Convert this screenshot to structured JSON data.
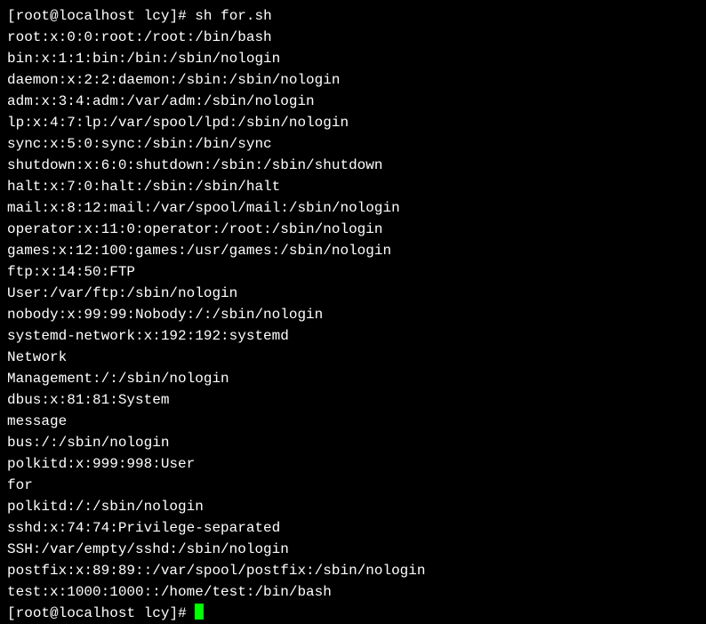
{
  "prompt1": {
    "user": "root",
    "at": "@",
    "host": "localhost",
    "path": "lcy",
    "symbol": "#",
    "command": "sh for.sh"
  },
  "output": [
    "root:x:0:0:root:/root:/bin/bash",
    "bin:x:1:1:bin:/bin:/sbin/nologin",
    "daemon:x:2:2:daemon:/sbin:/sbin/nologin",
    "adm:x:3:4:adm:/var/adm:/sbin/nologin",
    "lp:x:4:7:lp:/var/spool/lpd:/sbin/nologin",
    "sync:x:5:0:sync:/sbin:/bin/sync",
    "shutdown:x:6:0:shutdown:/sbin:/sbin/shutdown",
    "halt:x:7:0:halt:/sbin:/sbin/halt",
    "mail:x:8:12:mail:/var/spool/mail:/sbin/nologin",
    "operator:x:11:0:operator:/root:/sbin/nologin",
    "games:x:12:100:games:/usr/games:/sbin/nologin",
    "ftp:x:14:50:FTP",
    "User:/var/ftp:/sbin/nologin",
    "nobody:x:99:99:Nobody:/:/sbin/nologin",
    "systemd-network:x:192:192:systemd",
    "Network",
    "Management:/:/sbin/nologin",
    "dbus:x:81:81:System",
    "message",
    "bus:/:/sbin/nologin",
    "polkitd:x:999:998:User",
    "for",
    "polkitd:/:/sbin/nologin",
    "sshd:x:74:74:Privilege-separated",
    "SSH:/var/empty/sshd:/sbin/nologin",
    "postfix:x:89:89::/var/spool/postfix:/sbin/nologin",
    "test:x:1000:1000::/home/test:/bin/bash"
  ],
  "prompt2": {
    "user": "root",
    "at": "@",
    "host": "localhost",
    "path": "lcy",
    "symbol": "#"
  }
}
